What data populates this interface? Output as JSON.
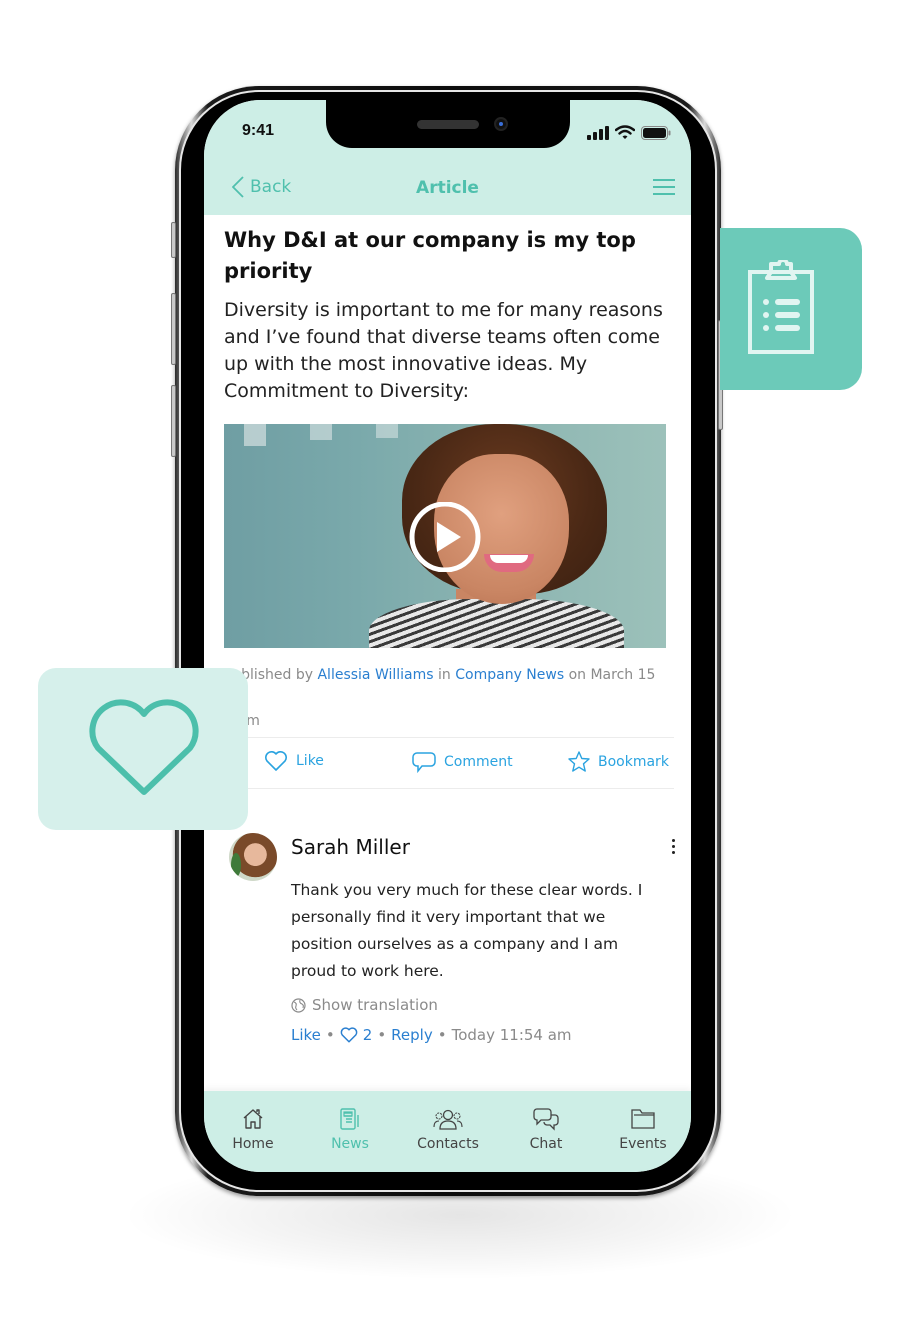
{
  "status_bar": {
    "time": "9:41"
  },
  "navbar": {
    "back_label": "Back",
    "title": "Article",
    "menu_icon": "hamburger-icon"
  },
  "article": {
    "title": "Why D&I at our company is my top priority",
    "body": "Diversity is important to me for many reasons and I’ve found that diverse teams often come up with the most innovative ideas. My Commitment to Diversity:",
    "video": {
      "play_icon": "play-icon"
    },
    "meta": {
      "prefix": "Published by",
      "author": "Allessia Williams",
      "in_label": "in",
      "category": "Company News",
      "date_text": "on March 15 at",
      "time_suffix": "5 pm"
    },
    "actions": [
      {
        "label": "Like",
        "icon": "heart-icon"
      },
      {
        "label": "Comment",
        "icon": "comment-icon"
      },
      {
        "label": "Bookmark",
        "icon": "star-icon"
      }
    ]
  },
  "comment": {
    "author": "Sarah Miller",
    "text": "Thank you very much for these clear words. I personally find it very important that we position ourselves as a company and I am proud to work here.",
    "translate_label": "Show translation",
    "like_label": "Like",
    "like_count": "2",
    "reply_label": "Reply",
    "timestamp": "Today 11:54 am",
    "separator": "•"
  },
  "tabbar": {
    "items": [
      {
        "label": "Home",
        "icon": "home-icon",
        "active": false
      },
      {
        "label": "News",
        "icon": "news-icon",
        "active": true
      },
      {
        "label": "Contacts",
        "icon": "contacts-icon",
        "active": false
      },
      {
        "label": "Chat",
        "icon": "chat-icon",
        "active": false
      },
      {
        "label": "Events",
        "icon": "folder-icon",
        "active": false
      }
    ]
  },
  "colors": {
    "accent": "#4fc0ad",
    "header_bg": "#cdeee6",
    "link": "#2a7fd0",
    "action": "#2aa3e0",
    "clipboard_card": "#6ccab9",
    "heart_card": "#d6f0eb"
  }
}
